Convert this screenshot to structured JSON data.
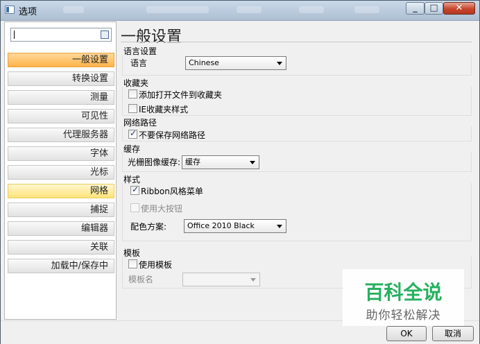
{
  "window": {
    "title": "选项"
  },
  "sidebar": {
    "search_value": "",
    "items": [
      {
        "label": "一般设置",
        "state": "active"
      },
      {
        "label": "转换设置",
        "state": "normal"
      },
      {
        "label": "测量",
        "state": "normal"
      },
      {
        "label": "可见性",
        "state": "normal"
      },
      {
        "label": "代理服务器",
        "state": "normal"
      },
      {
        "label": "字体",
        "state": "normal"
      },
      {
        "label": "光标",
        "state": "normal"
      },
      {
        "label": "网格",
        "state": "hover"
      },
      {
        "label": "捕捉",
        "state": "normal"
      },
      {
        "label": "编辑器",
        "state": "normal"
      },
      {
        "label": "关联",
        "state": "normal"
      },
      {
        "label": "加载中/保存中",
        "state": "normal"
      }
    ]
  },
  "main": {
    "heading": "一般设置",
    "language": {
      "group": "语言设置",
      "label": "语言",
      "value": "Chinese"
    },
    "favorites": {
      "group": "收藏夹",
      "opt1": "添加打开文件到收藏夹",
      "opt1_checked": false,
      "opt2": "IE收藏夹样式",
      "opt2_checked": false
    },
    "network": {
      "group": "网络路径",
      "opt1": "不要保存网络路径",
      "opt1_checked": true
    },
    "cache": {
      "group": "缓存",
      "label": "光栅图像缓存:",
      "value": "缓存"
    },
    "style": {
      "group": "样式",
      "ribbon": "Ribbon风格菜单",
      "ribbon_checked": true,
      "large_buttons": "使用大按钮",
      "large_buttons_checked": false,
      "scheme_label": "配色方案:",
      "scheme_value": "Office 2010 Black"
    },
    "template": {
      "group": "模板",
      "use": "使用模板",
      "use_checked": false,
      "name_label": "模板名",
      "name_value": ""
    }
  },
  "footer": {
    "ok": "OK",
    "cancel": "取消"
  },
  "watermark": {
    "line1": "百科全说",
    "line2": "助你轻松解决"
  }
}
